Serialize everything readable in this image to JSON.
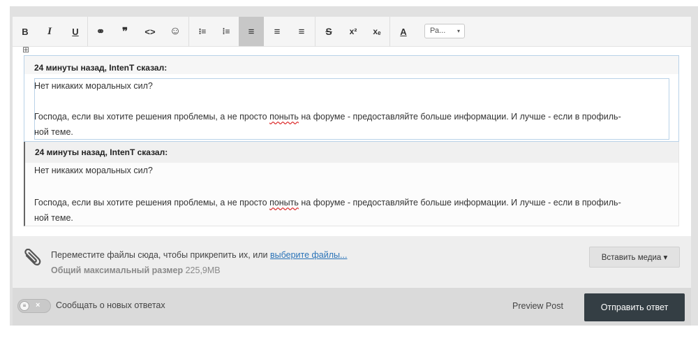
{
  "toolbar": {
    "bold": "B",
    "italic": "I",
    "underline": "U",
    "link": "⚭",
    "quote": "❞",
    "code": "<>",
    "emoji": "☺",
    "bullet_list": "⁝≡",
    "numbered_list": "⁞≡",
    "align_left": "≡",
    "align_center": "≡",
    "align_right": "≡",
    "strike": "S",
    "superscript": "x²",
    "subscript": "xₑ",
    "font_color": "A",
    "font_size": "Ра...",
    "font_size_caret": "▾"
  },
  "move_handle": "⊞",
  "quote": {
    "author_line": "24 минуты назад, IntenT сказал:",
    "line1": "Нет никаких моральных сил?",
    "line2_before": "Господа, если вы хотите решения проблемы, а не просто ",
    "line2_misspelled": "поныть",
    "line2_after": " на форуме - предоставляйте больше информации. И лучше - если в профиль-",
    "line3": "ной теме."
  },
  "attach": {
    "text": "Переместите файлы сюда, чтобы прикрепить их, или ",
    "link": "выберите файлы...",
    "size_label": "Общий максимальный размер",
    "size_value": " 225,9MB",
    "media_button": "Вставить медиа ▾"
  },
  "footer": {
    "toggle_x": "×",
    "toggle_knob": "≡",
    "notify": "Сообщать о новых ответах",
    "preview": "Preview Post",
    "submit": "Отправить ответ"
  },
  "colors": {
    "submit_bg": "#343e44",
    "link": "#2a73b8",
    "quote_border": "#b9d2e8"
  }
}
